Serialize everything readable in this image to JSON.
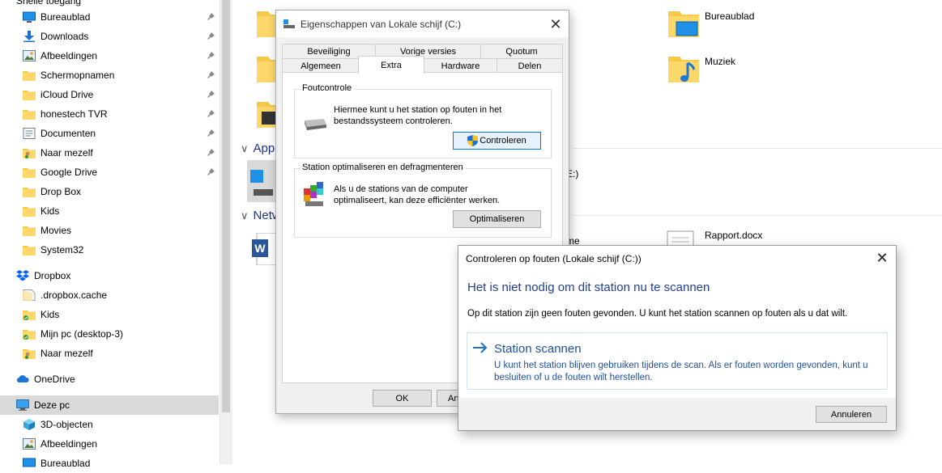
{
  "nav": {
    "quick_access_partial": "Snelle toegang",
    "quick_access": [
      {
        "label": "Bureaublad",
        "icon": "desktop-icon",
        "pinned": true
      },
      {
        "label": "Downloads",
        "icon": "download-icon",
        "pinned": true
      },
      {
        "label": "Afbeeldingen",
        "icon": "pictures-icon",
        "pinned": true
      },
      {
        "label": "Schermopnamen",
        "icon": "folder-icon",
        "pinned": true
      },
      {
        "label": "iCloud Drive",
        "icon": "folder-icon",
        "pinned": true
      },
      {
        "label": "honestech TVR",
        "icon": "folder-icon",
        "pinned": true
      },
      {
        "label": "Documenten",
        "icon": "documents-icon",
        "pinned": true
      },
      {
        "label": "Naar mezelf",
        "icon": "folder-user-icon",
        "pinned": true
      },
      {
        "label": "Google Drive",
        "icon": "folder-icon",
        "pinned": true
      },
      {
        "label": "Drop Box",
        "icon": "folder-icon",
        "pinned": false
      },
      {
        "label": "Kids",
        "icon": "folder-icon",
        "pinned": false
      },
      {
        "label": "Movies",
        "icon": "folder-icon",
        "pinned": false
      },
      {
        "label": "System32",
        "icon": "folder-icon",
        "pinned": false
      }
    ],
    "dropbox": {
      "label": "Dropbox",
      "icon": "dropbox-icon"
    },
    "dropbox_items": [
      {
        "label": ".dropbox.cache",
        "icon": "folder-blank-icon"
      },
      {
        "label": "Kids",
        "icon": "folder-synced-icon"
      },
      {
        "label": "Mijn pc (desktop-3)",
        "icon": "folder-synced-icon"
      },
      {
        "label": "Naar mezelf",
        "icon": "folder-user-icon"
      }
    ],
    "onedrive": {
      "label": "OneDrive",
      "icon": "cloud-icon"
    },
    "this_pc": {
      "label": "Deze pc",
      "icon": "computer-icon"
    },
    "this_pc_items": [
      {
        "label": "3D-objecten",
        "icon": "cube-icon"
      },
      {
        "label": "Afbeeldingen",
        "icon": "pictures-icon"
      },
      {
        "label": "Bureaublad",
        "icon": "desktop-icon"
      }
    ]
  },
  "content": {
    "folders": [
      {
        "label": "Bureaublad"
      },
      {
        "label": "Muziek"
      }
    ],
    "groups": [
      {
        "label": "Apparaten en stations"
      },
      {
        "label": "Netwerklocaties"
      }
    ],
    "drive_partial": "E:)",
    "file_partial": "me",
    "recent_file": {
      "label": "Rapport.docx"
    }
  },
  "props_dialog": {
    "title": "Eigenschappen van Lokale schijf (C:)",
    "tabs_row1": [
      "Beveiliging",
      "Vorige versies",
      "Quotum"
    ],
    "tabs_row2": [
      "Algemeen",
      "Extra",
      "Hardware",
      "Delen"
    ],
    "active_tab": "Extra",
    "error_check": {
      "group_label": "Foutcontrole",
      "description": "Hiermee kunt u het station op fouten in het bestandssysteem controleren.",
      "button": "Controleren"
    },
    "optimize": {
      "group_label": "Station optimaliseren en defragmenteren",
      "description": "Als u de stations van de computer optimaliseert, kan deze efficiënter werken.",
      "button": "Optimaliseren"
    },
    "ok_button": "OK",
    "cancel_partial": "An"
  },
  "check_dialog": {
    "title": "Controleren op fouten (Lokale schijf (C:))",
    "heading": "Het is niet nodig om dit station nu te scannen",
    "info": "Op dit station zijn geen fouten gevonden. U kunt het station scannen op fouten als u dat wilt.",
    "scan_title": "Station scannen",
    "scan_description": "U kunt het station blijven gebruiken tijdens de scan. Als er fouten worden gevonden, kunt u besluiten of u de fouten wilt herstellen.",
    "cancel_button": "Annuleren"
  },
  "colors": {
    "accent": "#0078d7",
    "heading_blue": "#1f3f8f",
    "folder_yellow": "#f7c948",
    "selection": "#d9d9d9"
  }
}
